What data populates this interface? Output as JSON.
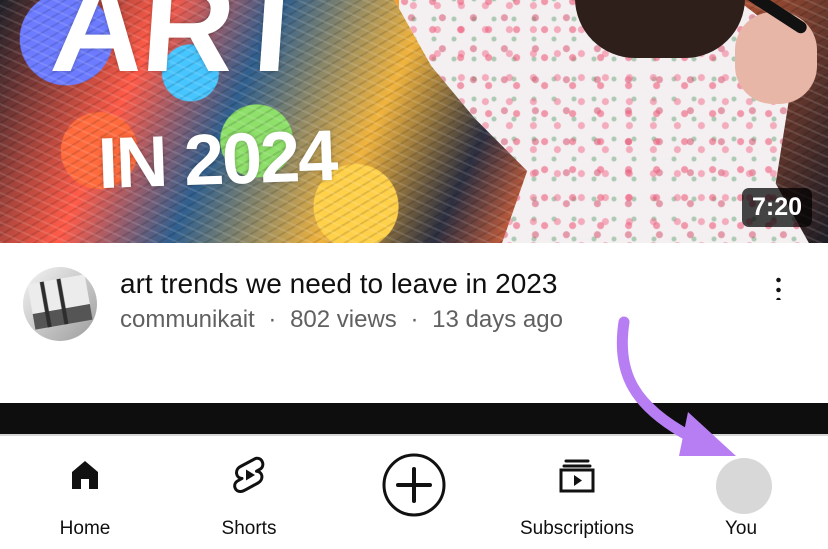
{
  "thumbnail": {
    "title_line_1": "ART",
    "title_line_2": "IN 2024",
    "duration": "7:20"
  },
  "video": {
    "title": "art trends we need to leave in 2023",
    "channel": "communikait",
    "separator_1": "·",
    "views": "802 views",
    "separator_2": "·",
    "age": "13 days ago"
  },
  "bottom_nav": {
    "home": "Home",
    "shorts": "Shorts",
    "subscriptions": "Subscriptions",
    "you": "You"
  },
  "colors": {
    "annotation_arrow": "#b77df2",
    "text_primary": "#0f0f0f",
    "text_secondary": "#606060",
    "nav_border": "#d6d6d6"
  },
  "icons": {
    "home": "home-icon",
    "shorts": "shorts-icon",
    "create": "create-icon",
    "subscriptions": "subscriptions-icon",
    "more": "more-vertical-icon"
  }
}
